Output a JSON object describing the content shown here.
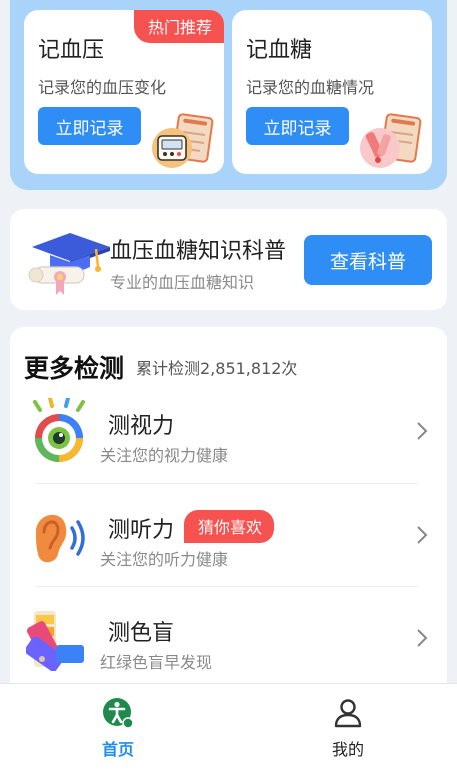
{
  "records": [
    {
      "title": "记血压",
      "description": "记录您的血压变化",
      "button": "立即记录",
      "tag": "热门推荐",
      "icon": "blood-pressure-monitor-icon"
    },
    {
      "title": "记血糖",
      "description": "记录您的血糖情况",
      "button": "立即记录",
      "icon": "blood-glucose-meter-icon"
    }
  ],
  "knowledge": {
    "title": "血压血糖知识科普",
    "subtitle": "专业的血压血糖知识",
    "button": "查看科普",
    "icon": "graduation-cap-icon"
  },
  "more_tests": {
    "title": "更多检测",
    "count_text": "累计检测2,851,812次",
    "items": [
      {
        "name": "测视力",
        "description": "关注您的视力健康",
        "icon": "eye-icon"
      },
      {
        "name": "测听力",
        "description": "关注您的听力健康",
        "tag": "猜你喜欢",
        "icon": "ear-icon"
      },
      {
        "name": "测色盲",
        "description": "红绿色盲早发现",
        "icon": "color-palette-icon"
      }
    ]
  },
  "nav": [
    {
      "label": "首页",
      "icon": "home-accessibility-icon",
      "active": true
    },
    {
      "label": "我的",
      "icon": "user-icon",
      "active": false
    }
  ],
  "colors": {
    "accent": "#2f8ef5",
    "tag_red": "#f55250",
    "panel_blue": "#a9d3f9",
    "nav_active": "#1f8ee6"
  }
}
